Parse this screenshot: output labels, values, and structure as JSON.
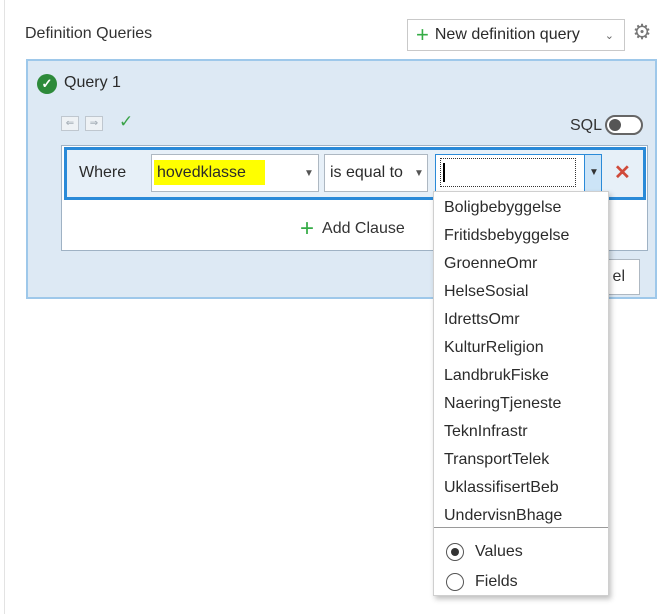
{
  "header": {
    "title": "Definition Queries",
    "new_query_label": "New definition query"
  },
  "query": {
    "title": "Query 1",
    "sql_label": "SQL",
    "sql_toggle_on": false,
    "clause": {
      "where_label": "Where",
      "field_value": "hovedklasse",
      "operator_value": "is equal to",
      "value_value": ""
    },
    "add_clause_label": "Add Clause",
    "cancel_label_visible": "el"
  },
  "dropdown": {
    "items": [
      "Boligbebyggelse",
      "Fritidsbebyggelse",
      "GroenneOmr",
      "HelseSosial",
      "IdrettsOmr",
      "KulturReligion",
      "LandbrukFiske",
      "NaeringTjeneste",
      "TeknInfrastr",
      "TransportTelek",
      "UklassifisertBeb",
      "UndervisnBhage"
    ],
    "radio_options": [
      {
        "label": "Values",
        "checked": true
      },
      {
        "label": "Fields",
        "checked": false
      }
    ]
  },
  "colors": {
    "accent_blue": "#2a8ad8",
    "panel_bg": "#dde9f4",
    "add_green": "#35ac46",
    "remove_red": "#d04a3a",
    "highlight_yellow": "#ffff00"
  },
  "icons": [
    "gear-icon",
    "plus-icon",
    "check-circle-icon",
    "checkmark-icon",
    "close-icon",
    "chevron-down-icon"
  ]
}
